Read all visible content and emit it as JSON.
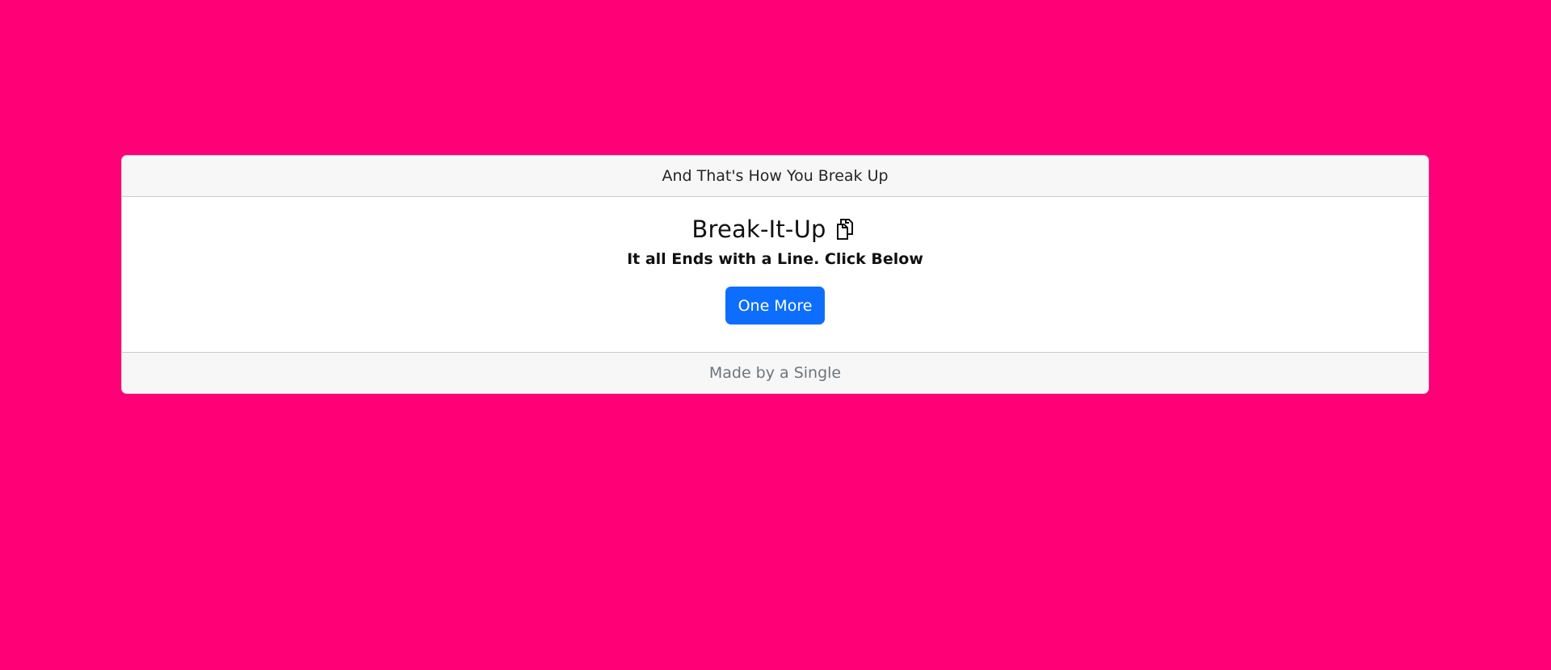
{
  "page": {
    "background_color": "#ff0077"
  },
  "card": {
    "header_text": "And That's How You Break Up",
    "title": "Break-It-Up",
    "title_icon": "copy-icon",
    "subtitle": "It all Ends with a Line. Click Below",
    "button_label": "One More",
    "button_color": "#0d6efd",
    "footer_text": "Made by a Single"
  }
}
